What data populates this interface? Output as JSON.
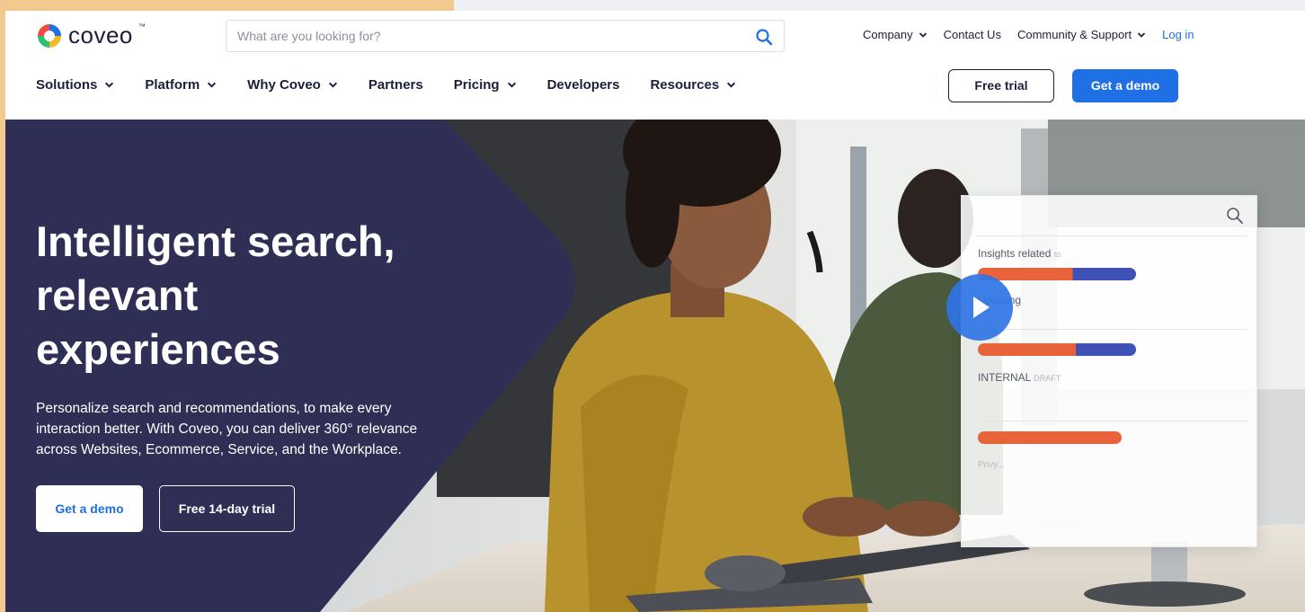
{
  "brand": {
    "name": "coveo",
    "tm": "™"
  },
  "search": {
    "placeholder": "What are you looking for?"
  },
  "util_nav": {
    "company": "Company",
    "contact": "Contact Us",
    "community": "Community & Support",
    "login": "Log in"
  },
  "main_nav": [
    {
      "label": "Solutions"
    },
    {
      "label": "Platform"
    },
    {
      "label": "Why Coveo"
    },
    {
      "label": "Partners"
    },
    {
      "label": "Pricing"
    },
    {
      "label": "Developers"
    },
    {
      "label": "Resources"
    }
  ],
  "header_buttons": {
    "free_trial": "Free trial",
    "get_demo": "Get a demo"
  },
  "hero": {
    "title": "Intelligent search, relevant experiences",
    "subtitle": "Personalize search and recommendations, to make every interaction better. With Coveo, you can deliver 360° relevance across Websites, Ecommerce, Service, and the Workplace.",
    "cta_demo": "Get a demo",
    "cta_trial": "Free 14-day trial"
  },
  "card": {
    "insights": "Insights related",
    "insights_faded": "to",
    "updating": "Updating",
    "internal": "INTERNAL",
    "internal_faded": "DRAFT",
    "faded": "Privy..."
  },
  "colors": {
    "brand_blue": "#1f6fe5",
    "navy": "#2f2f55",
    "text_dark": "#1c1f3b",
    "bar_orange": "#e8623a",
    "bar_blue": "#3f51b5"
  }
}
